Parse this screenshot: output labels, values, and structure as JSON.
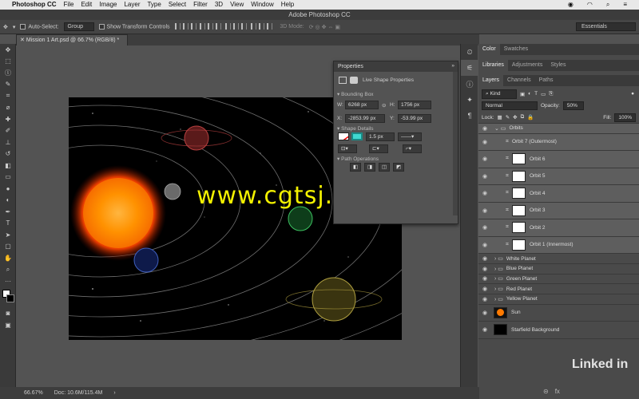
{
  "menubar": {
    "app_name": "Photoshop CC",
    "items": [
      "File",
      "Edit",
      "Image",
      "Layer",
      "Type",
      "Select",
      "Filter",
      "3D",
      "View",
      "Window",
      "Help"
    ]
  },
  "window_title": "Adobe Photoshop CC",
  "options": {
    "auto_select_label": "Auto-Select:",
    "auto_select_value": "Group",
    "show_transform_label": "Show Transform Controls",
    "mode_3d_label": "3D Mode:",
    "workspace": "Essentials"
  },
  "document": {
    "tab_title": "Mission 1 Art.psd @ 66.7% (RGB/8) *",
    "zoom": "66.67%",
    "doc_size": "Doc: 10.6M/115.4M"
  },
  "watermark": "www.cgtsj.com",
  "properties": {
    "title": "Properties",
    "shape_label": "Live Shape Properties",
    "bounding_box": "Bounding Box",
    "w_label": "W:",
    "w_value": "6268 px",
    "h_label": "H:",
    "h_value": "1756 px",
    "x_label": "X:",
    "x_value": "-2853.99 px",
    "y_label": "Y:",
    "y_value": "-53.99 px",
    "shape_details": "Shape Details",
    "stroke_width": "1.5 px",
    "path_operations": "Path Operations"
  },
  "panels": {
    "top_tabs": [
      "Color",
      "Swatches"
    ],
    "mid_tabs": [
      "Libraries",
      "Adjustments",
      "Styles"
    ],
    "layer_tabs": [
      "Layers",
      "Channels",
      "Paths"
    ],
    "filter_kind": "Kind",
    "blend_mode": "Normal",
    "opacity_label": "Opacity:",
    "opacity_value": "50%",
    "lock_label": "Lock:",
    "fill_label": "Fill:",
    "fill_value": "100%"
  },
  "layers": [
    {
      "name": "Orbits",
      "type": "group-open",
      "selected": true
    },
    {
      "name": "Orbit 7 (Outermost)",
      "type": "shape",
      "selected": true
    },
    {
      "name": "Orbit 6",
      "type": "shape",
      "selected": true
    },
    {
      "name": "Orbit 5",
      "type": "shape",
      "selected": true
    },
    {
      "name": "Orbit 4",
      "type": "shape",
      "selected": true
    },
    {
      "name": "Orbit 3",
      "type": "shape",
      "selected": true
    },
    {
      "name": "Orbit 2",
      "type": "shape",
      "selected": true
    },
    {
      "name": "Orbit 1 (Innermost)",
      "type": "shape",
      "selected": true
    },
    {
      "name": "White Planet",
      "type": "group"
    },
    {
      "name": "Blue Planet",
      "type": "group"
    },
    {
      "name": "Green Planet",
      "type": "group"
    },
    {
      "name": "Red Planet",
      "type": "group"
    },
    {
      "name": "Yellow Planet",
      "type": "group"
    },
    {
      "name": "Sun",
      "type": "image"
    },
    {
      "name": "Starfield Background",
      "type": "image"
    }
  ],
  "brand": "Linked in"
}
